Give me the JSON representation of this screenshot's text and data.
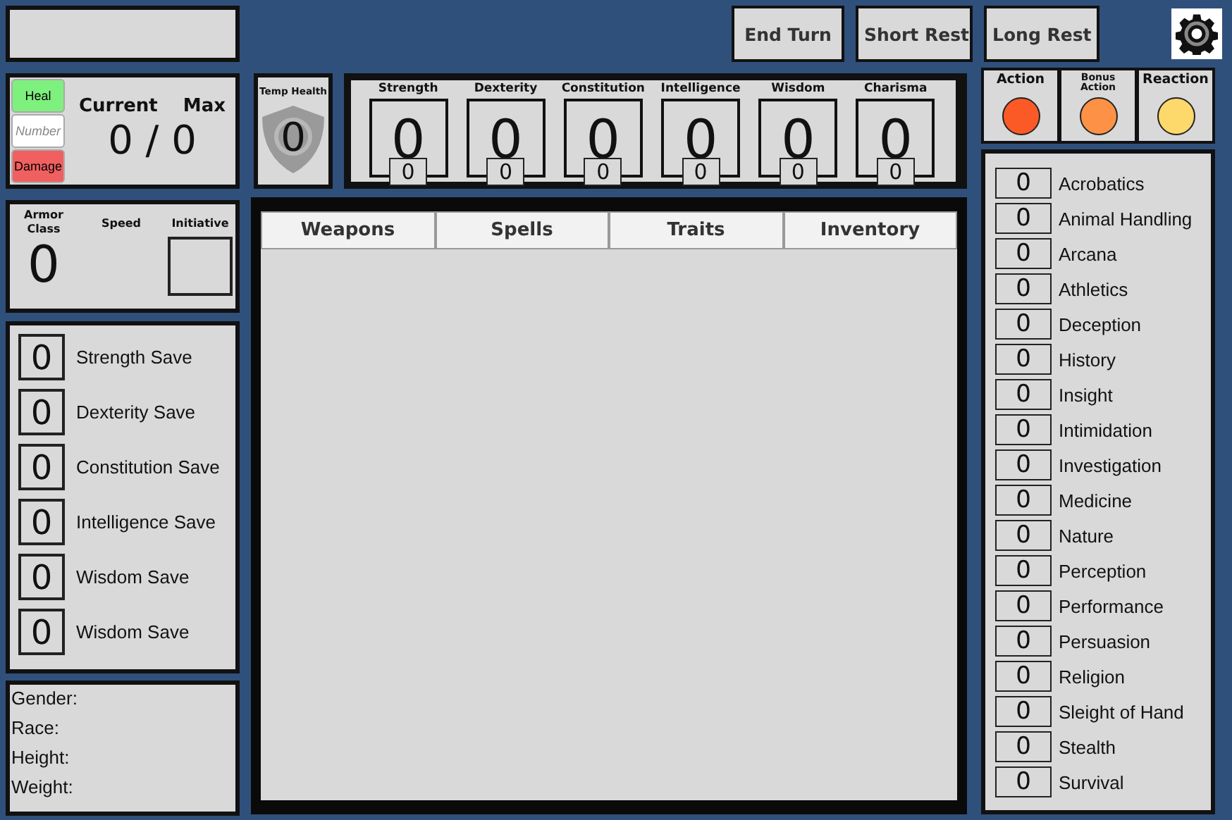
{
  "top_buttons": [
    {
      "label": "End Turn"
    },
    {
      "label": "Short Rest"
    },
    {
      "label": "Long Rest"
    }
  ],
  "health": {
    "heal_label": "Heal",
    "amount_placeholder": "Number",
    "damage_label": "Damage",
    "current_label": "Current",
    "max_label": "Max",
    "value": "0 / 0"
  },
  "temp_health": {
    "label": "Temp Health",
    "value": "0"
  },
  "abilities": [
    {
      "name": "Strength",
      "score": "0",
      "modifier": "0"
    },
    {
      "name": "Dexterity",
      "score": "0",
      "modifier": "0"
    },
    {
      "name": "Constitution",
      "score": "0",
      "modifier": "0"
    },
    {
      "name": "Intelligence",
      "score": "0",
      "modifier": "0"
    },
    {
      "name": "Wisdom",
      "score": "0",
      "modifier": "0"
    },
    {
      "name": "Charisma",
      "score": "0",
      "modifier": "0"
    }
  ],
  "actions": [
    {
      "label": "Action",
      "color": "#fb5a27"
    },
    {
      "label": "Bonus Action",
      "color": "#fd9145"
    },
    {
      "label": "Reaction",
      "color": "#fdd86a"
    }
  ],
  "combat": {
    "armor_class_label": "Armor Class",
    "armor_class": "0",
    "speed_label": "Speed",
    "initiative_label": "Initiative"
  },
  "saves": [
    {
      "value": "0",
      "label": "Strength Save"
    },
    {
      "value": "0",
      "label": "Dexterity Save"
    },
    {
      "value": "0",
      "label": "Constitution Save"
    },
    {
      "value": "0",
      "label": "Intelligence Save"
    },
    {
      "value": "0",
      "label": "Wisdom Save"
    },
    {
      "value": "0",
      "label": "Wisdom Save"
    }
  ],
  "bio": [
    {
      "label": "Gender:"
    },
    {
      "label": "Race:"
    },
    {
      "label": "Height:"
    },
    {
      "label": "Weight:"
    }
  ],
  "tabs": [
    {
      "label": "Weapons",
      "selected": false
    },
    {
      "label": "Spells",
      "selected": false
    },
    {
      "label": "Traits",
      "selected": false
    },
    {
      "label": "Inventory",
      "selected": false
    }
  ],
  "skills": [
    {
      "value": "0",
      "label": "Acrobatics"
    },
    {
      "value": "0",
      "label": "Animal Handling"
    },
    {
      "value": "0",
      "label": "Arcana"
    },
    {
      "value": "0",
      "label": "Athletics"
    },
    {
      "value": "0",
      "label": "Deception"
    },
    {
      "value": "0",
      "label": "History"
    },
    {
      "value": "0",
      "label": "Insight"
    },
    {
      "value": "0",
      "label": "Intimidation"
    },
    {
      "value": "0",
      "label": "Investigation"
    },
    {
      "value": "0",
      "label": "Medicine"
    },
    {
      "value": "0",
      "label": "Nature"
    },
    {
      "value": "0",
      "label": "Perception"
    },
    {
      "value": "0",
      "label": "Performance"
    },
    {
      "value": "0",
      "label": "Persuasion"
    },
    {
      "value": "0",
      "label": "Religion"
    },
    {
      "value": "0",
      "label": "Sleight of Hand"
    },
    {
      "value": "0",
      "label": "Stealth"
    },
    {
      "value": "0",
      "label": "Survival"
    }
  ]
}
